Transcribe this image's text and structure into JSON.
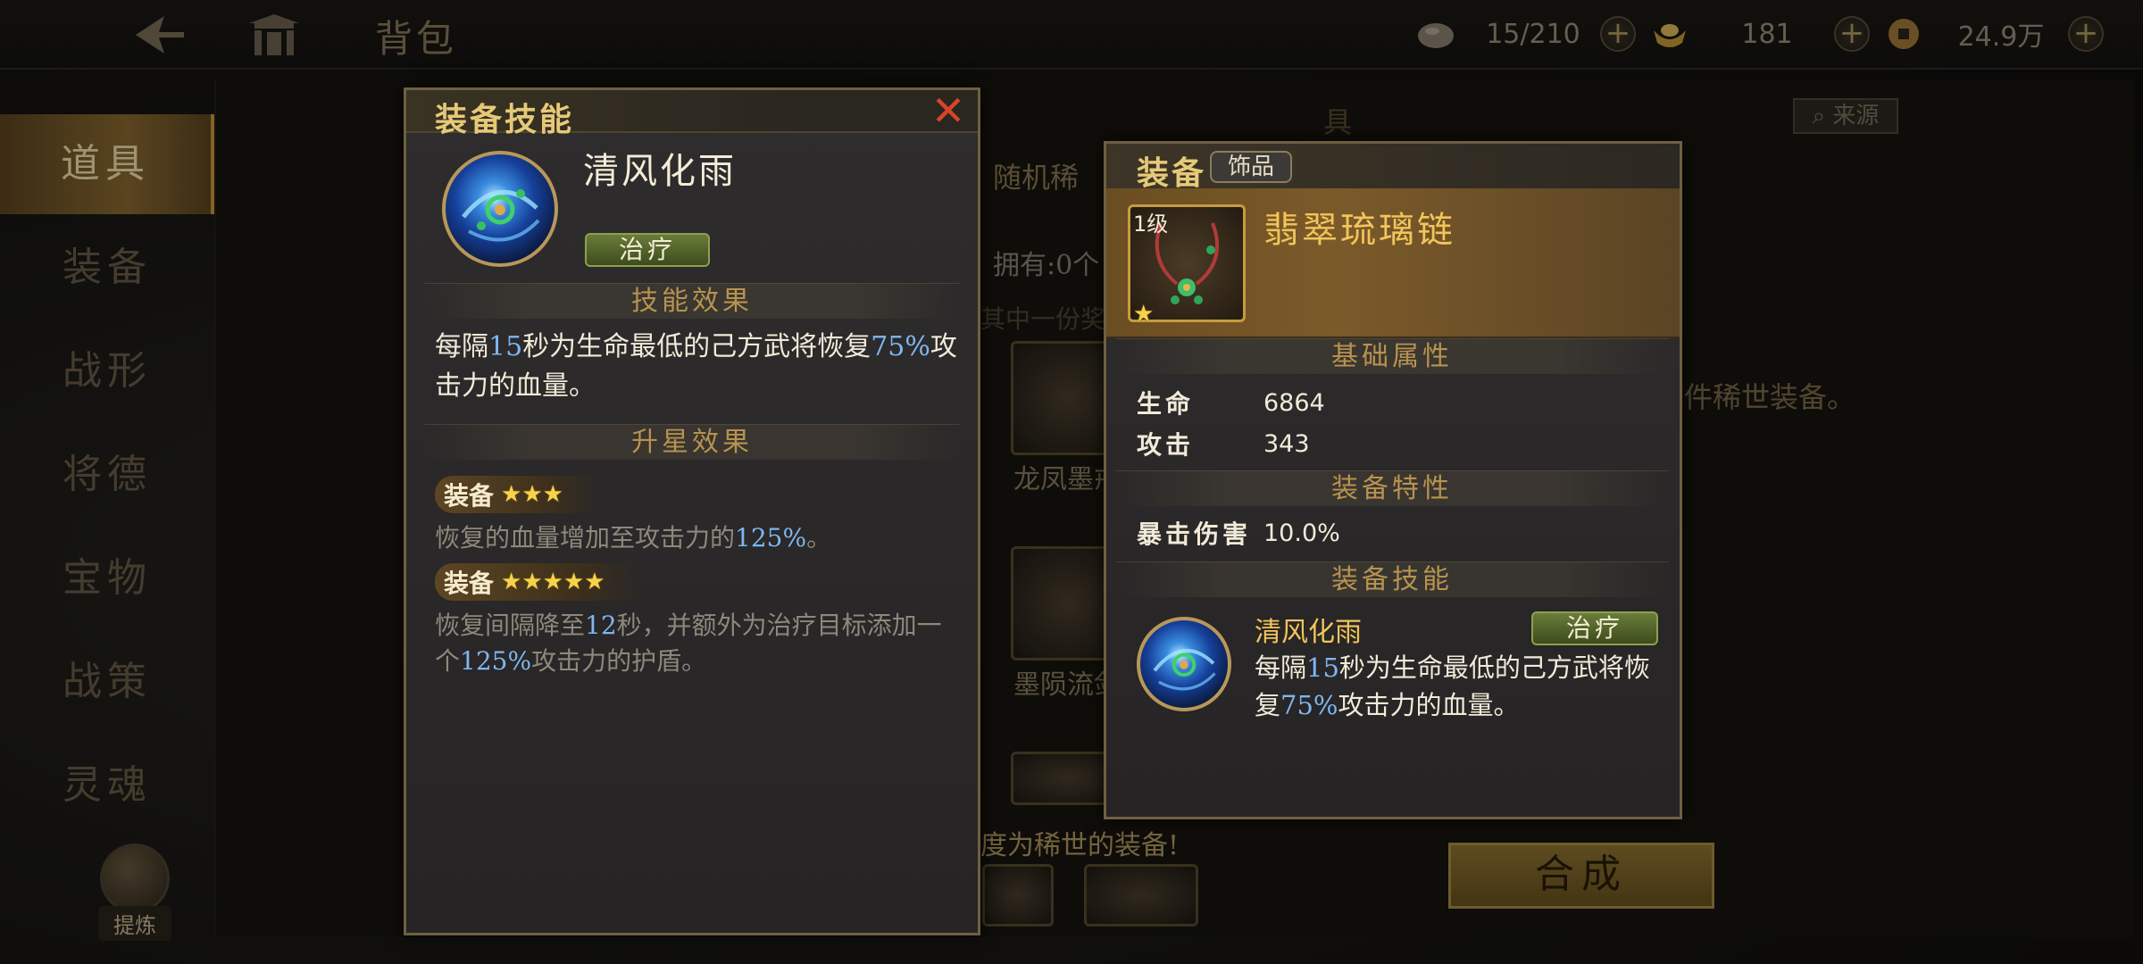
{
  "topbar": {
    "page_title": "背包",
    "resources": [
      {
        "icon": "stone-icon",
        "value": "15/210"
      },
      {
        "icon": "gold-ingot-icon",
        "value": "181"
      },
      {
        "icon": "copper-coin-icon",
        "value": "24.9万"
      }
    ]
  },
  "sidebar": {
    "items": [
      {
        "label": "道具",
        "active": true
      },
      {
        "label": "装备",
        "active": false
      },
      {
        "label": "战形",
        "active": false
      },
      {
        "label": "将德",
        "active": false
      },
      {
        "label": "宝物",
        "active": false
      },
      {
        "label": "战策",
        "active": false
      },
      {
        "label": "灵魂",
        "active": false
      }
    ],
    "refine_label": "提炼"
  },
  "background_panel": {
    "header_partial": "具",
    "source_label": "来源",
    "random_label": "随机稀",
    "owned_label": "拥有:0个",
    "one_of_label": "其中一份奖",
    "items": [
      {
        "name": "龙凤墨戒"
      },
      {
        "name": "墨陨流剑"
      }
    ],
    "rare_note": "件稀世装备。",
    "bottom_note": "度为稀世的装备!",
    "compose_label": "合成"
  },
  "skill_popup": {
    "title": "装备技能",
    "skill_name": "清风化雨",
    "tag": "治疗",
    "effect_heading": "技能效果",
    "effect_parts": [
      "每隔",
      "15",
      "秒为生命最低的己方武将恢复",
      "75%",
      "攻击力的血量。"
    ],
    "star_heading": "升星效果",
    "star_effects": [
      {
        "label": "装备",
        "stars": 3,
        "parts": [
          "恢复的血量增加至攻击力的",
          "125%",
          "。"
        ]
      },
      {
        "label": "装备",
        "stars": 5,
        "parts": [
          "恢复间隔降至",
          "12",
          "秒，并额外为治疗目标添加一个",
          "125%",
          "攻击力的护盾。"
        ]
      }
    ]
  },
  "equip_popup": {
    "title": "装备",
    "type_badge": "饰品",
    "item_level": "1级",
    "item_stars": 1,
    "item_name": "翡翠琉璃链",
    "base_heading": "基础属性",
    "base_stats": [
      {
        "name": "生命",
        "value": "6864"
      },
      {
        "name": "攻击",
        "value": "343"
      }
    ],
    "trait_heading": "装备特性",
    "traits": [
      {
        "name": "暴击伤害",
        "value": "10.0%"
      }
    ],
    "skill_heading": "装备技能",
    "skill_name": "清风化雨",
    "skill_tag": "治疗",
    "skill_parts": [
      "每隔",
      "15",
      "秒为生命最低的己方武将恢复",
      "75%",
      "攻击力的血量。"
    ]
  },
  "colors": {
    "accent_gold": "#e6c978",
    "highlight_blue": "#7fb6f2",
    "close_red": "#d8442a",
    "heal_green": "#6a7c3a"
  }
}
